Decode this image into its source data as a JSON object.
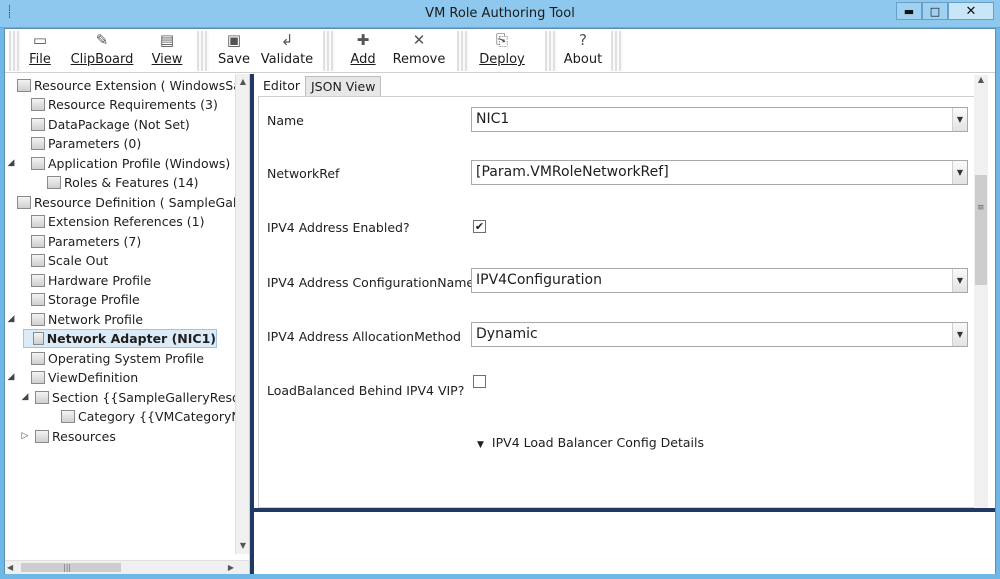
{
  "window": {
    "title": "VM Role Authoring Tool",
    "minimize_glyph": "▬",
    "maximize_glyph": "□",
    "close_glyph": "✕"
  },
  "toolbar": {
    "file_label": "File",
    "clipboard_label": "ClipBoard",
    "view_label": "View",
    "save_label": "Save",
    "validate_label": "Validate",
    "add_label": "Add",
    "remove_label": "Remove",
    "deploy_label": "Deploy",
    "about_label": "About"
  },
  "tree": {
    "items": [
      {
        "label": "Resource Extension ( WindowsSamp",
        "expander": ""
      },
      {
        "label": "Resource Requirements (3)",
        "expander": ""
      },
      {
        "label": "DataPackage (Not Set)",
        "expander": ""
      },
      {
        "label": "Parameters (0)",
        "expander": ""
      },
      {
        "label": "Application Profile (Windows)",
        "expander": "◢"
      },
      {
        "label": "Roles & Features (14)",
        "expander": ""
      },
      {
        "label": "Resource Definition ( SampleGallery",
        "expander": ""
      },
      {
        "label": "Extension References (1)",
        "expander": ""
      },
      {
        "label": "Parameters (7)",
        "expander": ""
      },
      {
        "label": "Scale Out",
        "expander": ""
      },
      {
        "label": "Hardware Profile",
        "expander": ""
      },
      {
        "label": "Storage Profile",
        "expander": ""
      },
      {
        "label": "Network Profile",
        "expander": "◢"
      },
      {
        "label": "Network Adapter (NIC1)",
        "expander": ""
      },
      {
        "label": "Operating System Profile",
        "expander": ""
      },
      {
        "label": "ViewDefinition",
        "expander": "◢"
      },
      {
        "label": "Section {{SampleGalleryResour",
        "expander": "◢"
      },
      {
        "label": "Category {{VMCategoryNar",
        "expander": ""
      },
      {
        "label": "Resources",
        "expander": "▷"
      }
    ]
  },
  "tabs": {
    "editor": "Editor",
    "json_view": "JSON View"
  },
  "form": {
    "name_label": "Name",
    "name_value": "NIC1",
    "networkref_label": "NetworkRef",
    "networkref_value": "[Param.VMRoleNetworkRef]",
    "ipv4_enabled_label": "IPV4 Address Enabled?",
    "ipv4_enabled_checked": true,
    "ipv4_config_label": "IPV4 Address ConfigurationName",
    "ipv4_config_value": "IPV4Configuration",
    "ipv4_alloc_label": "IPV4 Address AllocationMethod",
    "ipv4_alloc_value": "Dynamic",
    "lb_label": "LoadBalanced Behind IPV4 VIP?",
    "lb_checked": false,
    "lb_details_label": "IPV4 Load Balancer Config Details"
  },
  "colors": {
    "titlebar": "#8ec8ef",
    "accent_dark": "#1f3864",
    "selection": "#dcebf8"
  }
}
